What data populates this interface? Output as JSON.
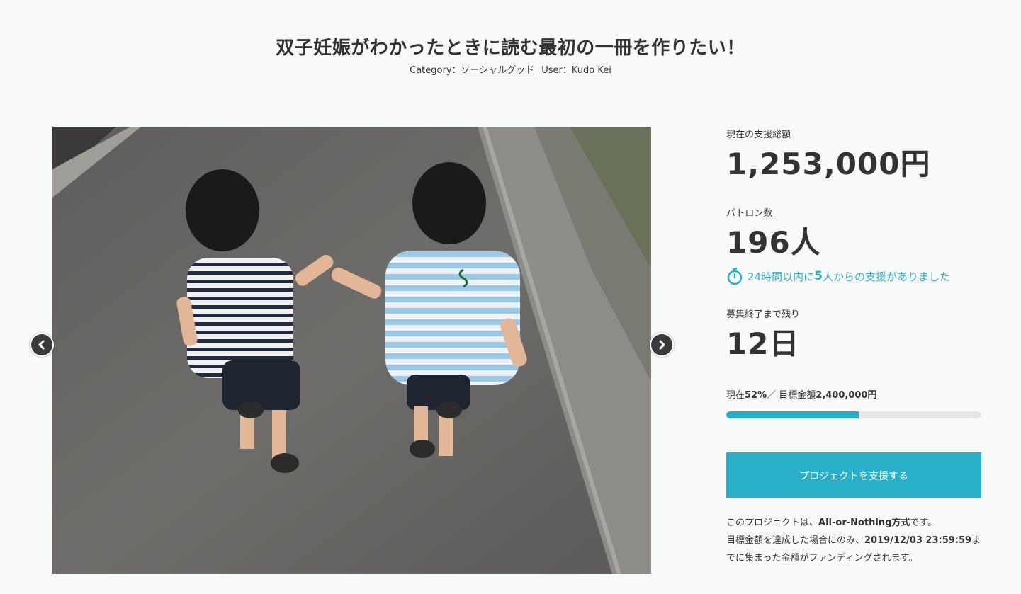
{
  "project": {
    "title": "双子妊娠がわかったときに読む最初の一冊を作りたい！"
  },
  "meta": {
    "category_label": "Category：",
    "category_value": "ソーシャルグッド",
    "user_label": "User：",
    "user_value": "Kudo Kei"
  },
  "gallery": {
    "prev_icon": "chevron-left-icon",
    "next_icon": "chevron-right-icon"
  },
  "stats": {
    "total_label": "現在の支援総額",
    "total_value": "1,253,000円",
    "patrons_label": "パトロン数",
    "patrons_value": "196人",
    "recent_prefix": "24時間以内に",
    "recent_count": "5",
    "recent_suffix": "人からの支援がありました",
    "remaining_label": "募集終了まで残り",
    "remaining_value": "12日"
  },
  "progress": {
    "current_prefix": "現在",
    "percent_text": "52%",
    "separator": "／ 目標金額",
    "goal_amount": "2,400,000円",
    "fraction": 0.52
  },
  "cta": {
    "label": "プロジェクトを支援する"
  },
  "note": {
    "line1_prefix": "このプロジェクトは、",
    "line1_bold": "All-or-Nothing方式",
    "line1_suffix": "です。",
    "line2_prefix": "目標金額を達成した場合にのみ、",
    "deadline": "2019/12/03 23:59:59",
    "line2_suffix": "までに集まった金額がファンディングされます。"
  },
  "colors": {
    "accent": "#29b0c8",
    "text": "#333333",
    "background": "#f8f9f9",
    "bar_track": "#e6e6e6"
  }
}
